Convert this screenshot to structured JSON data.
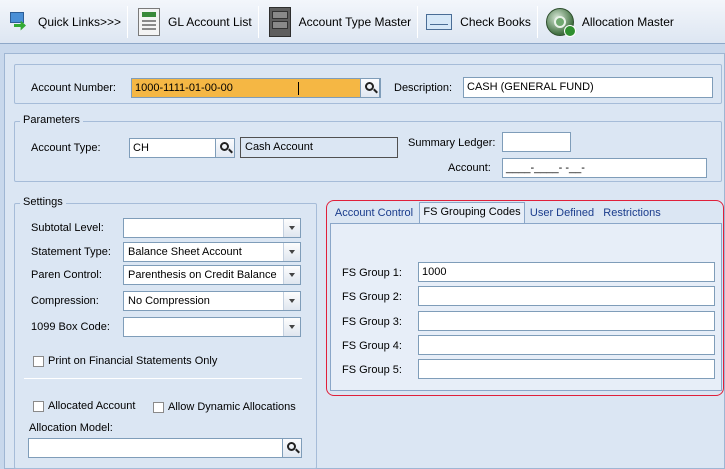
{
  "toolbar": {
    "quick_links": "Quick Links>>>",
    "gl_account_list": "GL Account List",
    "account_type_master": "Account Type Master",
    "check_books": "Check Books",
    "allocation_master": "Allocation Master"
  },
  "header": {
    "account_number_label": "Account Number:",
    "account_number_value": "1000-1111-01-00-00",
    "description_label": "Description:",
    "description_value": "CASH (GENERAL FUND)"
  },
  "parameters": {
    "title": "Parameters",
    "account_type_label": "Account Type:",
    "account_type_value": "CH",
    "account_type_desc": "Cash Account",
    "summary_ledger_label": "Summary Ledger:",
    "summary_ledger_value": "",
    "account_label": "Account:",
    "account_value": "____-____- -__-"
  },
  "settings": {
    "title": "Settings",
    "subtotal_level_label": "Subtotal Level:",
    "subtotal_level_value": "",
    "statement_type_label": "Statement Type:",
    "statement_type_value": "Balance Sheet Account",
    "paren_control_label": "Paren Control:",
    "paren_control_value": "Parenthesis on Credit Balance",
    "compression_label": "Compression:",
    "compression_value": "No Compression",
    "box_1099_label": "1099 Box Code:",
    "box_1099_value": "",
    "print_fs_only_label": "Print on Financial Statements Only",
    "allocated_account_label": "Allocated Account",
    "allow_dynamic_label": "Allow Dynamic Allocations",
    "allocation_model_label": "Allocation Model:",
    "allocation_model_value": ""
  },
  "tabs": {
    "items": [
      "Account Control",
      "FS  Grouping Codes",
      "User Defined",
      "Restrictions"
    ],
    "active": "FS  Grouping Codes"
  },
  "fs_groups": {
    "group1_label": "FS Group 1:",
    "group1_value": "1000",
    "group2_label": "FS Group 2:",
    "group2_value": "",
    "group3_label": "FS Group 3:",
    "group3_value": "",
    "group4_label": "FS Group 4:",
    "group4_value": "",
    "group5_label": "FS Group 5:",
    "group5_value": ""
  },
  "colors": {
    "highlight_field": "#f5b744",
    "annotation_frame": "#e0203a",
    "panel_background": "#dbe6f3"
  }
}
